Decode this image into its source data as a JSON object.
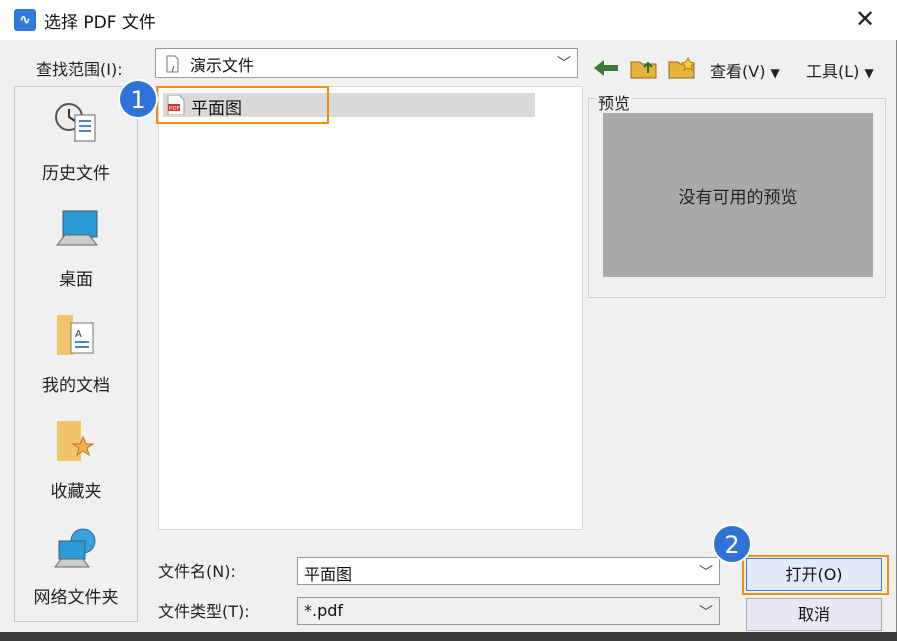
{
  "window": {
    "title": "选择 PDF 文件",
    "close_glyph": "✕",
    "app_icon": "wps-pdf-icon"
  },
  "lookin": {
    "label": "查找范围(I):",
    "value": "演示文件"
  },
  "toolbar": {
    "view_label": "查看(V)",
    "tools_label": "工具(L)",
    "dropdown_glyph": "▼"
  },
  "places": [
    {
      "label": "历史文件",
      "icon": "history-icon"
    },
    {
      "label": "桌面",
      "icon": "desktop-icon"
    },
    {
      "label": "我的文档",
      "icon": "documents-icon"
    },
    {
      "label": "收藏夹",
      "icon": "favorites-icon"
    },
    {
      "label": "网络文件夹",
      "icon": "network-folder-icon"
    }
  ],
  "files": [
    {
      "name": "平面图",
      "type": "PDF"
    }
  ],
  "preview": {
    "legend": "预览",
    "empty_text": "没有可用的预览"
  },
  "filename": {
    "label": "文件名(N):",
    "value": "平面图"
  },
  "filetype": {
    "label": "文件类型(T):",
    "value": "*.pdf"
  },
  "buttons": {
    "open": "打开(O)",
    "cancel": "取消"
  },
  "annotations": {
    "step1": "1",
    "step2": "2"
  },
  "colors": {
    "highlight": "#f0900d",
    "badge": "#2f73d8"
  }
}
